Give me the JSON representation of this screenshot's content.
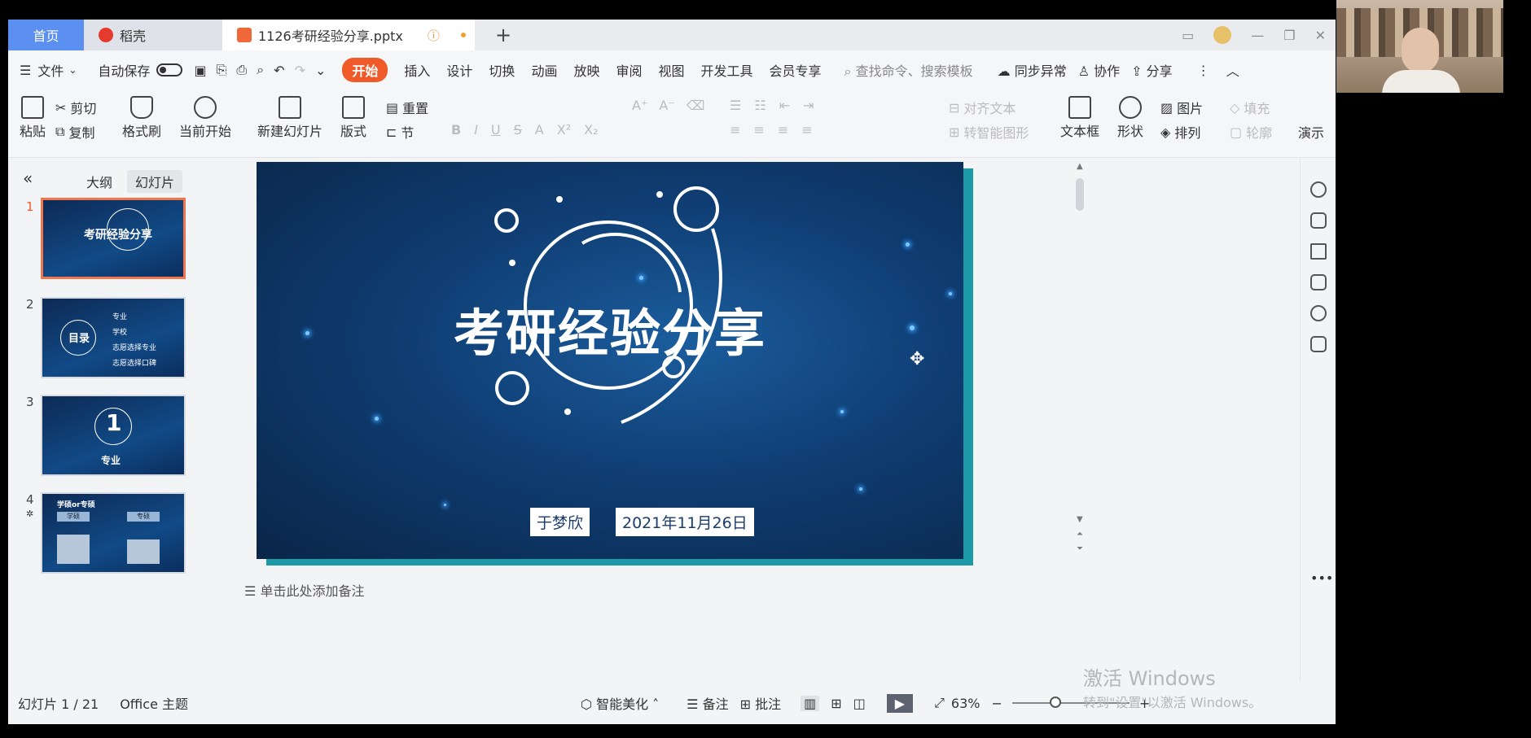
{
  "tabs": {
    "home": "首页",
    "daoke": "稻壳",
    "file": "1126考研经验分享.pptx",
    "warn_icon": "!"
  },
  "menu": {
    "file": "文件",
    "autosave": "自动保存",
    "items": [
      "开始",
      "插入",
      "设计",
      "切换",
      "动画",
      "放映",
      "审阅",
      "视图",
      "开发工具",
      "会员专享"
    ],
    "search": "查找命令、搜索模板",
    "sync": "同步异常",
    "collab": "协作",
    "share": "分享"
  },
  "ribbon": {
    "paste": "粘贴",
    "cut": "剪切",
    "copy": "复制",
    "format_painter": "格式刷",
    "from_current": "当前开始",
    "new_slide": "新建幻灯片",
    "layout": "版式",
    "reset": "重置",
    "section": "节",
    "align_text": "对齐文本",
    "smart_graphic": "转智能图形",
    "textbox": "文本框",
    "shape": "形状",
    "picture": "图片",
    "arrange": "排列",
    "fill": "填充",
    "outline": "轮廓",
    "present": "演示"
  },
  "left": {
    "outline_tab": "大纲",
    "slides_tab": "幻灯片",
    "numbers": [
      "1",
      "2",
      "3",
      "4"
    ],
    "thumb1_title": "考研经验分享",
    "thumb2_title": "目录",
    "thumb2_items": [
      "专业",
      "学校",
      "志愿选择专业",
      "志愿选择口碑"
    ],
    "thumb3_num": "1",
    "thumb3_label": "专业",
    "thumb4_title": "学硕or专硕",
    "thumb4_cols": [
      "学硕",
      "专硕"
    ]
  },
  "slide": {
    "title": "考研经验分享",
    "author": "于梦欣",
    "date": "2021年11月26日"
  },
  "notes": "单击此处添加备注",
  "status": {
    "slide_info": "幻灯片 1 / 21",
    "theme": "Office 主题",
    "beautify": "智能美化",
    "notes": "备注",
    "comments": "批注",
    "zoom": "63%"
  },
  "watermark": {
    "line1": "激活 Windows",
    "line2": "转到\"设置\"以激活 Windows。"
  },
  "colors": {
    "accent": "#f05a28",
    "home_tab": "#5b8ff0",
    "slide_bg": "#0f3d73"
  }
}
